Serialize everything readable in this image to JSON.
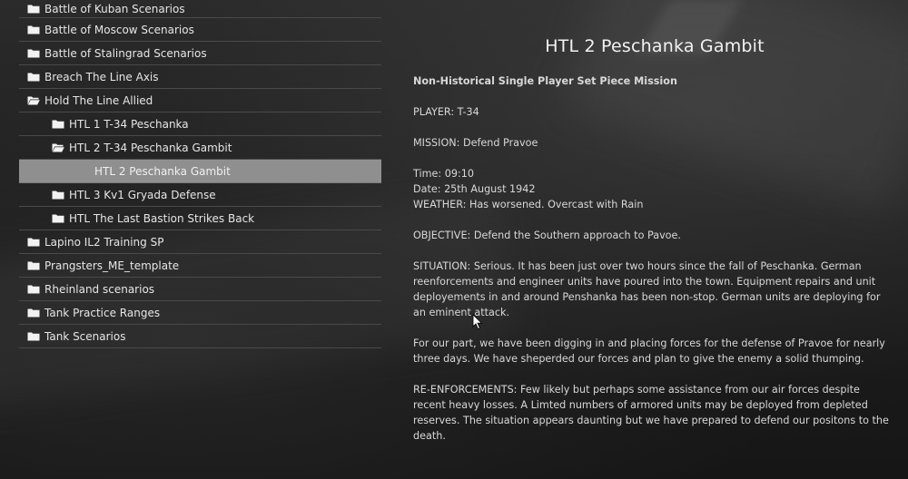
{
  "tree": {
    "items": [
      {
        "label": "Battle of Kuban Scenarios",
        "level": 0,
        "icon": "folder-closed-icon",
        "expanded": false,
        "selected": false
      },
      {
        "label": "Battle of Moscow Scenarios",
        "level": 0,
        "icon": "folder-closed-icon",
        "expanded": false,
        "selected": false
      },
      {
        "label": "Battle of Stalingrad Scenarios",
        "level": 0,
        "icon": "folder-closed-icon",
        "expanded": false,
        "selected": false
      },
      {
        "label": "Breach The Line Axis",
        "level": 0,
        "icon": "folder-closed-icon",
        "expanded": false,
        "selected": false
      },
      {
        "label": "Hold The Line Allied",
        "level": 0,
        "icon": "folder-open-icon",
        "expanded": true,
        "selected": false
      },
      {
        "label": "HTL 1 T-34 Peschanka",
        "level": 1,
        "icon": "folder-closed-icon",
        "expanded": false,
        "selected": false
      },
      {
        "label": "HTL 2 T-34 Peschanka Gambit",
        "level": 1,
        "icon": "folder-open-icon",
        "expanded": true,
        "selected": false
      },
      {
        "label": "HTL 2 Peschanka Gambit",
        "level": 2,
        "icon": "",
        "expanded": false,
        "selected": true
      },
      {
        "label": "HTL 3 Kv1 Gryada Defense",
        "level": 1,
        "icon": "folder-closed-icon",
        "expanded": false,
        "selected": false
      },
      {
        "label": "HTL The Last Bastion Strikes Back",
        "level": 1,
        "icon": "folder-closed-icon",
        "expanded": false,
        "selected": false
      },
      {
        "label": "Lapino IL2 Training SP",
        "level": 0,
        "icon": "folder-closed-icon",
        "expanded": false,
        "selected": false
      },
      {
        "label": "Prangsters_ME_template",
        "level": 0,
        "icon": "folder-closed-icon",
        "expanded": false,
        "selected": false
      },
      {
        "label": "Rheinland scenarios",
        "level": 0,
        "icon": "folder-closed-icon",
        "expanded": false,
        "selected": false
      },
      {
        "label": "Tank Practice Ranges",
        "level": 0,
        "icon": "folder-closed-icon",
        "expanded": false,
        "selected": false
      },
      {
        "label": "Tank Scenarios",
        "level": 0,
        "icon": "folder-closed-icon",
        "expanded": false,
        "selected": false
      }
    ]
  },
  "briefing": {
    "title": "HTL 2 Peschanka Gambit",
    "subtitle": "Non-Historical Single Player Set Piece Mission",
    "player": "PLAYER: T-34",
    "mission": "MISSION: Defend Pravoe",
    "time": "Time: 09:10",
    "date": "Date: 25th August 1942",
    "weather": "WEATHER: Has worsened. Overcast with Rain",
    "objective": "OBJECTIVE: Defend the Southern approach to Pavoe.",
    "situation": "SITUATION: Serious. It has been just over two hours since the fall of Peschanka. German reenforcements and engineer units have poured into the town. Equipment repairs and unit deployements in and around Penshanka has been non-stop. German units are deploying for an eminent attack.",
    "our_part": "For our part, we have been digging in and placing forces for the defense of Pravoe for nearly three days. We have sheperded our forces and plan to give the enemy a solid thumping.",
    "reinforcements": "RE-ENFORCEMENTS: Few likely but perhaps some assistance from our air forces despite recent heavy losses. A Limted numbers of armored units may be deployed from depleted reserves. The situation appears daunting but we have prepared to defend our positons to the death."
  },
  "colors": {
    "selected_row": "#8f8f8f",
    "separator": "#4a4a4a",
    "text": "#e6e6e6"
  }
}
